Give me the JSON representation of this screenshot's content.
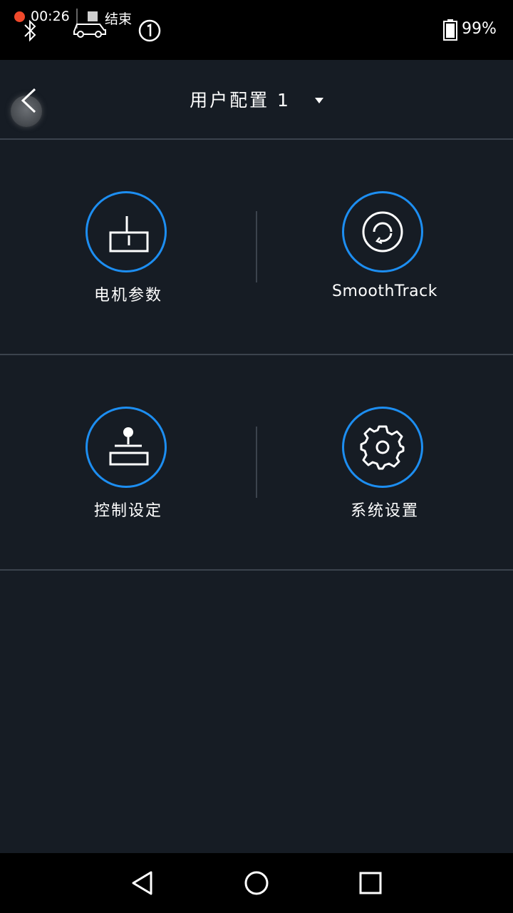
{
  "status_bar": {
    "time": "00:26",
    "end_label": "结束",
    "battery": "99%",
    "icons": [
      "record-dot-icon",
      "bluetooth-icon",
      "stop-icon",
      "car-icon",
      "circled-one-icon",
      "battery-icon"
    ],
    "rec_color": "#f0492b"
  },
  "header": {
    "title": "用户配置 1",
    "back_icon": "chevron-left-icon",
    "dropdown_icon": "caret-down-icon"
  },
  "menu": {
    "accent": "#1d8ef1",
    "items": [
      {
        "label": "电机参数",
        "icon": "motor-icon"
      },
      {
        "label": "SmoothTrack",
        "icon": "rotate-icon"
      },
      {
        "label": "控制设定",
        "icon": "joystick-icon"
      },
      {
        "label": "系统设置",
        "icon": "gear-icon"
      }
    ]
  },
  "nav_bar": {
    "icons": [
      "back-triangle-icon",
      "home-circle-icon",
      "recents-square-icon"
    ]
  }
}
